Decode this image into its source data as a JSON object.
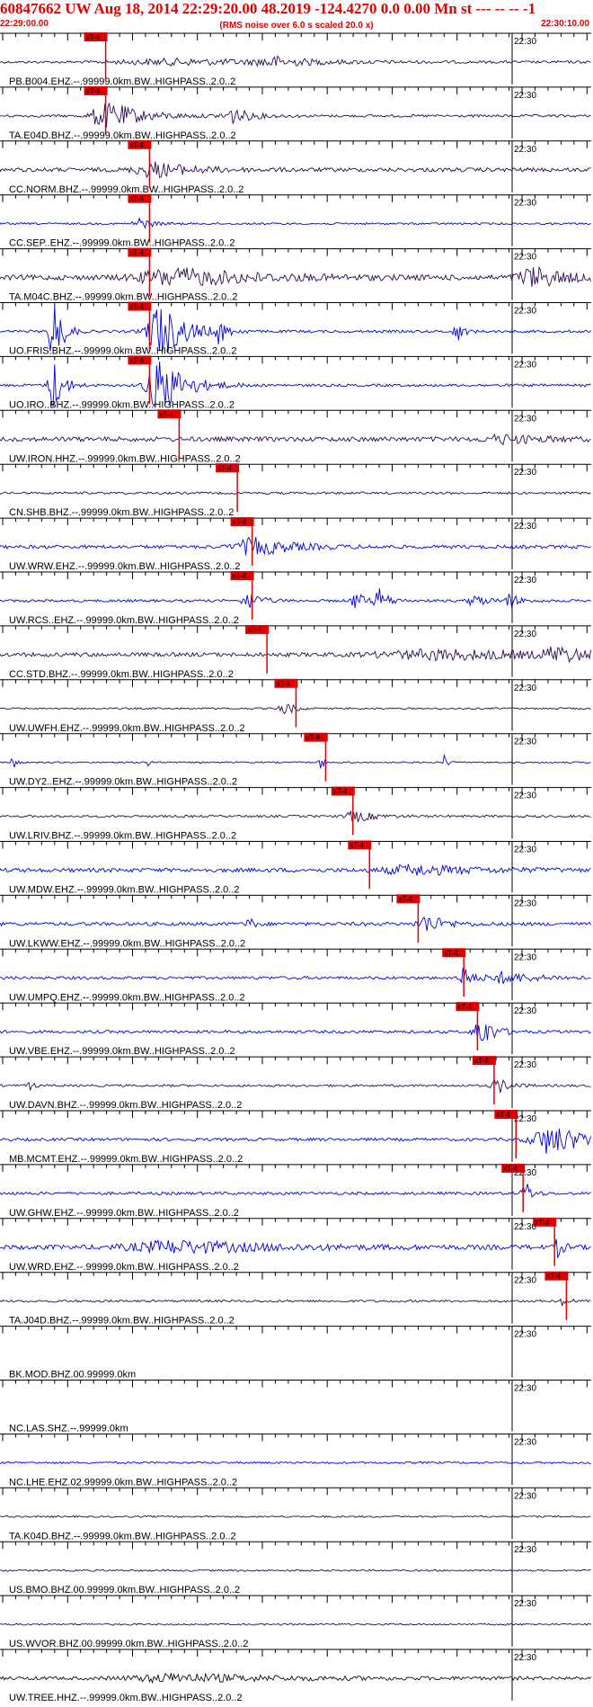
{
  "header": {
    "title": "60847662 UW Aug 18, 2014 22:29:20.00   48.2019 -124.4270  0.0 0.00 Mn st --- -- --   -1",
    "start_time": "22:29:00.00",
    "note": "(RMS noise over 6.0 s scaled 20.0 x)",
    "end_time": "22:30:10.00"
  },
  "colors": {
    "red": "#e00000",
    "blue": "#0000dd",
    "dark": "#2a0a50",
    "black": "#111111"
  },
  "chart_data": {
    "type": "line",
    "title": "60847662 UW Aug 18, 2014 22:29:20.00   48.2019 -124.4270  0.0 0.00 Mn st --- -- --   -1",
    "x_range": [
      "22:29:00.00",
      "22:30:10.00"
    ],
    "time_mark_label": "22:30",
    "pick_label": "xT-4",
    "channels": [
      {
        "label": "PB.B004.EHZ.--.99999.0km.BW..HIGHPASS..2.0..2",
        "color": "dark",
        "pick": 0.163,
        "amp": 0.4,
        "events": [
          [
            0.3,
            0.2,
            1.0
          ],
          [
            0.46,
            0.05,
            1.6
          ]
        ]
      },
      {
        "label": "TA.E04D.BHZ.--.99999.0km.BW..HIGHPASS..2.0..2",
        "color": "dark",
        "pick": 0.163,
        "amp": 0.45,
        "events": [
          [
            0.17,
            0.03,
            3.5
          ],
          [
            0.2,
            0.06,
            2.5
          ],
          [
            0.39,
            0.03,
            2.8
          ]
        ]
      },
      {
        "label": "CC.NORM.BHZ.--.99999.0km.BW..HIGHPASS..2.0..2",
        "color": "dark",
        "pick": 0.237,
        "amp": 0.7,
        "events": [
          [
            0.26,
            0.06,
            2.5
          ]
        ]
      },
      {
        "label": "CC.SEP..EHZ.--.99999.0km.BW..HIGHPASS..2.0..2",
        "color": "blue",
        "pick": 0.237,
        "amp": 0.35,
        "events": [
          [
            0.235,
            0.02,
            2.0
          ]
        ]
      },
      {
        "label": "TA.M04C.BHZ.--.99999.0km.BW..HIGHPASS..2.0..2",
        "color": "dark",
        "pick": 0.237,
        "amp": 0.9,
        "events": [
          [
            0.3,
            0.12,
            3.0
          ],
          [
            0.9,
            0.05,
            3.5
          ]
        ]
      },
      {
        "label": "UO.FRIS.BHZ.--.99999.0km.BW..HIGHPASS..2.0..2",
        "color": "blue",
        "pick": 0.237,
        "amp": 0.45,
        "events": [
          [
            0.09,
            0.015,
            12.0
          ],
          [
            0.27,
            0.04,
            10.0
          ],
          [
            0.37,
            0.01,
            4.0
          ],
          [
            0.77,
            0.01,
            4.0
          ]
        ]
      },
      {
        "label": "UO.IRO..BHZ.--.99999.0km.BW..HIGHPASS..2.0..2",
        "color": "blue",
        "pick": 0.237,
        "amp": 0.45,
        "events": [
          [
            0.09,
            0.015,
            10.0
          ],
          [
            0.27,
            0.04,
            10.0
          ]
        ]
      },
      {
        "label": "UW.IRON.HHZ.--.99999.0km.BW..HIGHPASS..2.0..2",
        "color": "dark",
        "pick": 0.287,
        "amp": 0.8,
        "events": [
          [
            0.85,
            0.06,
            1.3
          ]
        ]
      },
      {
        "label": "CN.SHB.BHZ.--.99999.0km.BW..HIGHPASS..2.0..2",
        "color": "dark",
        "pick": 0.385,
        "amp": 0.4,
        "events": []
      },
      {
        "label": "UW.WRW.EHZ.--.99999.0km.BW..HIGHPASS..2.0..2",
        "color": "blue",
        "pick": 0.41,
        "amp": 0.6,
        "events": [
          [
            0.43,
            0.06,
            3.0
          ]
        ]
      },
      {
        "label": "UW.RCS..EHZ.--.99999.0km.BW..HIGHPASS..2.0..2",
        "color": "blue",
        "pick": 0.41,
        "amp": 0.45,
        "events": [
          [
            0.42,
            0.02,
            3.0
          ],
          [
            0.6,
            0.015,
            3.0
          ],
          [
            0.64,
            0.015,
            4.0
          ],
          [
            0.8,
            0.02,
            2.0
          ],
          [
            0.86,
            0.015,
            2.5
          ]
        ]
      },
      {
        "label": "CC.STD.BHZ.--.99999.0km.BW..HIGHPASS..2.0..2",
        "color": "dark",
        "pick": 0.435,
        "amp": 0.7,
        "events": [
          [
            0.75,
            0.2,
            1.6
          ],
          [
            0.94,
            0.04,
            2.5
          ]
        ]
      },
      {
        "label": "UW.UWFH.EHZ.--.99999.0km.BW..HIGHPASS..2.0..2",
        "color": "dark",
        "pick": 0.484,
        "amp": 0.3,
        "events": [
          [
            0.48,
            0.015,
            2.5
          ]
        ]
      },
      {
        "label": "UW.DY2..EHZ.--.99999.0km.BW..HIGHPASS..2.0..2",
        "color": "blue",
        "pick": 0.534,
        "amp": 0.25,
        "events": [
          [
            0.02,
            0.005,
            4.0
          ],
          [
            0.25,
            0.005,
            3.0
          ],
          [
            0.54,
            0.005,
            3.0
          ],
          [
            0.75,
            0.005,
            3.0
          ]
        ]
      },
      {
        "label": "UW.LRIV.BHZ.--.99999.0km.BW..HIGHPASS..2.0..2",
        "color": "dark",
        "pick": 0.58,
        "amp": 0.4,
        "events": [
          [
            0.6,
            0.03,
            2.0
          ]
        ]
      },
      {
        "label": "UW.MDW.EHZ.--.99999.0km.BW..HIGHPASS..2.0..2",
        "color": "blue",
        "pick": 0.608,
        "amp": 0.7,
        "events": [
          [
            0.7,
            0.1,
            1.6
          ]
        ]
      },
      {
        "label": "UW.LKWW.EHZ.--.99999.0km.BW..HIGHPASS..2.0..2",
        "color": "blue",
        "pick": 0.69,
        "amp": 0.6,
        "events": [
          [
            0.72,
            0.03,
            3.0
          ],
          [
            0.42,
            0.01,
            2.0
          ]
        ]
      },
      {
        "label": "UW.UMPQ.EHZ.--.99999.0km.BW..HIGHPASS..2.0..2",
        "color": "blue",
        "pick": 0.767,
        "amp": 0.5,
        "events": [
          [
            0.78,
            0.01,
            6.0
          ],
          [
            0.85,
            0.06,
            1.8
          ]
        ]
      },
      {
        "label": "UW.VBE.EHZ.--.99999.0km.BW..HIGHPASS..2.0..2",
        "color": "blue",
        "pick": 0.79,
        "amp": 0.5,
        "events": [
          [
            0.81,
            0.02,
            6.0
          ]
        ]
      },
      {
        "label": "UW.DAVN.BHZ.--.99999.0km.BW..HIGHPASS..2.0..2",
        "color": "dark",
        "pick": 0.818,
        "amp": 0.4,
        "events": [
          [
            0.05,
            0.005,
            3.0
          ],
          [
            0.84,
            0.02,
            2.5
          ]
        ]
      },
      {
        "label": "MB.MCMT.EHZ.--.99999.0km.BW..HIGHPASS..2.0..2",
        "color": "blue",
        "pick": 0.855,
        "amp": 0.5,
        "events": [
          [
            0.93,
            0.06,
            5.0
          ]
        ]
      },
      {
        "label": "UW.GHW.EHZ.--.99999.0km.BW..HIGHPASS..2.0..2",
        "color": "blue",
        "pick": 0.867,
        "amp": 0.5,
        "events": [
          [
            0.885,
            0.01,
            5.0
          ]
        ]
      },
      {
        "label": "UW.WRD.EHZ.--.99999.0km.BW..HIGHPASS..2.0..2",
        "color": "blue",
        "pick": 0.92,
        "amp": 0.8,
        "events": [
          [
            0.3,
            0.15,
            2.0
          ],
          [
            0.94,
            0.01,
            3.0
          ]
        ]
      },
      {
        "label": "TA.J04D.BHZ.--.99999.0km.BW..HIGHPASS..2.0..2",
        "color": "dark",
        "pick": 0.94,
        "amp": 0.4,
        "events": [
          [
            0.95,
            0.01,
            1.5
          ]
        ]
      },
      {
        "label": "BK.MOD.BHZ.00.99999.0km",
        "color": "dark",
        "pick": null,
        "amp": 0.0,
        "events": []
      },
      {
        "label": "NC.LAS.SHZ.--.99999.0km",
        "color": "dark",
        "pick": null,
        "amp": 0.0,
        "events": []
      },
      {
        "label": "NC.LHE.EHZ.02.99999.0km.BW..HIGHPASS..2.0..2",
        "color": "blue",
        "pick": null,
        "amp": 0.35,
        "events": []
      },
      {
        "label": "TA.K04D.BHZ.--.99999.0km.BW..HIGHPASS..2.0..2",
        "color": "dark",
        "pick": null,
        "amp": 0.3,
        "events": []
      },
      {
        "label": "US.BMO.BHZ.00.99999.0km.BW..HIGHPASS..2.0..2",
        "color": "dark",
        "pick": null,
        "amp": 0.3,
        "events": []
      },
      {
        "label": "US.WVOR.BHZ.00.99999.0km.BW..HIGHPASS..2.0..2",
        "color": "dark",
        "pick": null,
        "amp": 0.3,
        "events": []
      },
      {
        "label": "UW.TREE.HHZ.--.99999.0km.BW..HIGHPASS..2.0..2",
        "color": "black",
        "pick": null,
        "amp": 0.6,
        "events": [
          [
            0.3,
            0.15,
            1.4
          ]
        ]
      }
    ]
  }
}
